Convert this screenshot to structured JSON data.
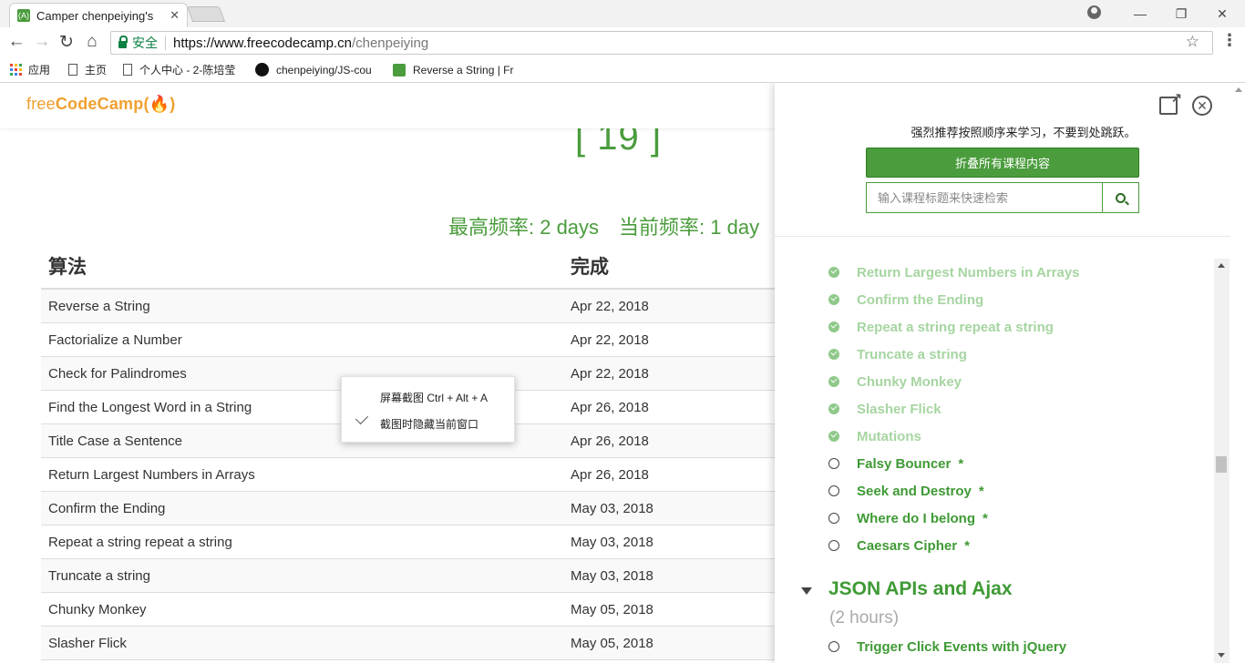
{
  "browser": {
    "tab_title": "Camper chenpeiying's",
    "tab_close": "✕",
    "window_controls": {
      "minimize": "—",
      "maximize": "❐",
      "close": "✕"
    },
    "secure_label": "安全",
    "url_host": "https://www.freecodecamp.cn",
    "url_path": "/chenpeiying",
    "bookmarks": [
      {
        "label": "应用",
        "icon": "apps-icon"
      },
      {
        "label": "主页",
        "icon": "doc-icon"
      },
      {
        "label": "个人中心 - 2-陈培莹",
        "icon": "doc-icon"
      },
      {
        "label": "chenpeiying/JS-cou",
        "icon": "github-icon"
      },
      {
        "label": "Reverse a String | Fr",
        "icon": "fcc-icon"
      }
    ]
  },
  "site": {
    "logo_free": "free",
    "logo_codecamp": "CodeCamp",
    "logo_flame": "(🔥)"
  },
  "profile": {
    "streak_count": "[ 19 ]",
    "longest_streak": "最高频率: 2 days",
    "current_streak": "当前频率: 1 day"
  },
  "table": {
    "headers": {
      "name": "算法",
      "date": "完成"
    },
    "rows": [
      {
        "name": "Reverse a String",
        "date": "Apr 22, 2018"
      },
      {
        "name": "Factorialize a Number",
        "date": "Apr 22, 2018"
      },
      {
        "name": "Check for Palindromes",
        "date": "Apr 22, 2018"
      },
      {
        "name": "Find the Longest Word in a String",
        "date": "Apr 26, 2018"
      },
      {
        "name": "Title Case a Sentence",
        "date": "Apr 26, 2018"
      },
      {
        "name": "Return Largest Numbers in Arrays",
        "date": "Apr 26, 2018"
      },
      {
        "name": "Confirm the Ending",
        "date": "May 03, 2018"
      },
      {
        "name": "Repeat a string repeat a string",
        "date": "May 03, 2018"
      },
      {
        "name": "Truncate a string",
        "date": "May 03, 2018"
      },
      {
        "name": "Chunky Monkey",
        "date": "May 05, 2018"
      },
      {
        "name": "Slasher Flick",
        "date": "May 05, 2018"
      }
    ]
  },
  "context_menu": {
    "item1": "屏幕截图 Ctrl + Alt + A",
    "item2": "截图时隐藏当前窗口"
  },
  "map_panel": {
    "hint": "强烈推荐按照顺序来学习，不要到处跳跃。",
    "collapse_button": "折叠所有课程内容",
    "search_placeholder": "输入课程标题来快速检索",
    "challenges": [
      {
        "label": "Return Largest Numbers in Arrays",
        "done": true,
        "star": ""
      },
      {
        "label": "Confirm the Ending",
        "done": true,
        "star": ""
      },
      {
        "label": "Repeat a string repeat a string",
        "done": true,
        "star": ""
      },
      {
        "label": "Truncate a string",
        "done": true,
        "star": ""
      },
      {
        "label": "Chunky Monkey",
        "done": true,
        "star": ""
      },
      {
        "label": "Slasher Flick",
        "done": true,
        "star": ""
      },
      {
        "label": "Mutations",
        "done": true,
        "star": ""
      },
      {
        "label": "Falsy Bouncer",
        "done": false,
        "star": "*"
      },
      {
        "label": "Seek and Destroy",
        "done": false,
        "star": "*"
      },
      {
        "label": "Where do I belong",
        "done": false,
        "star": "*"
      },
      {
        "label": "Caesars Cipher",
        "done": false,
        "star": "*"
      }
    ],
    "section_title": "JSON APIs and Ajax",
    "section_hours": "(2 hours)",
    "next_challenge": "Trigger Click Events with jQuery"
  },
  "colors": {
    "accent_green": "#4a9c3c",
    "done_green": "#a6d5a1",
    "logo_orange": "#f0a030"
  }
}
